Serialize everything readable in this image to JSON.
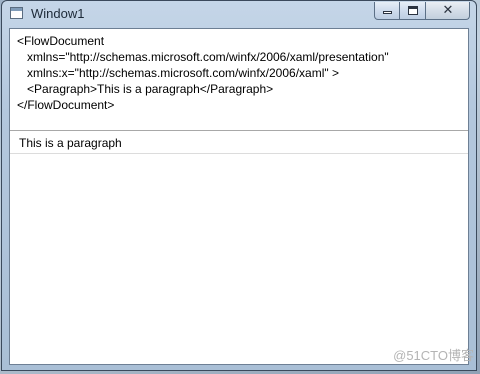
{
  "window": {
    "title": "Window1",
    "controls": {
      "minimize": "minimize",
      "maximize": "maximize",
      "close": "✕"
    }
  },
  "editor": {
    "lines": [
      "<FlowDocument",
      "   xmlns=\"http://schemas.microsoft.com/winfx/2006/xaml/presentation\"",
      "   xmlns:x=\"http://schemas.microsoft.com/winfx/2006/xaml\" >",
      "   <Paragraph>This is a paragraph</Paragraph>",
      "</FlowDocument>"
    ]
  },
  "viewer": {
    "paragraph": "This is a paragraph"
  },
  "watermark": "@51CTO博客",
  "colors": {
    "frame": "#b3c7dd",
    "client_border": "#6d7f94",
    "separator": "#a8a8a8"
  }
}
